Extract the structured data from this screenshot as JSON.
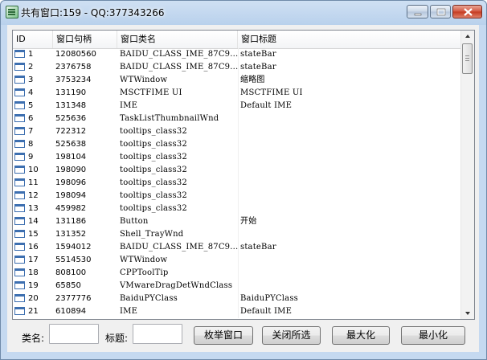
{
  "window": {
    "title": "共有窗口:159 - QQ:377343266",
    "icon": "app-icon"
  },
  "list": {
    "headers": {
      "id": "ID",
      "hwnd": "窗口句柄",
      "class": "窗口类名",
      "title": "窗口标题"
    },
    "rows": [
      {
        "id": "1",
        "hwnd": "12080560",
        "class": "BAIDU_CLASS_IME_87C9...",
        "title": "stateBar"
      },
      {
        "id": "2",
        "hwnd": "2376758",
        "class": "BAIDU_CLASS_IME_87C9...",
        "title": "stateBar"
      },
      {
        "id": "3",
        "hwnd": "3753234",
        "class": "WTWindow",
        "title": "缩略图"
      },
      {
        "id": "4",
        "hwnd": "131190",
        "class": "MSCTFIME UI",
        "title": "MSCTFIME UI"
      },
      {
        "id": "5",
        "hwnd": "131348",
        "class": "IME",
        "title": "Default IME"
      },
      {
        "id": "6",
        "hwnd": "525636",
        "class": "TaskListThumbnailWnd",
        "title": ""
      },
      {
        "id": "7",
        "hwnd": "722312",
        "class": "tooltips_class32",
        "title": ""
      },
      {
        "id": "8",
        "hwnd": "525638",
        "class": "tooltips_class32",
        "title": ""
      },
      {
        "id": "9",
        "hwnd": "198104",
        "class": "tooltips_class32",
        "title": ""
      },
      {
        "id": "10",
        "hwnd": "198090",
        "class": "tooltips_class32",
        "title": ""
      },
      {
        "id": "11",
        "hwnd": "198096",
        "class": "tooltips_class32",
        "title": ""
      },
      {
        "id": "12",
        "hwnd": "198094",
        "class": "tooltips_class32",
        "title": ""
      },
      {
        "id": "13",
        "hwnd": "459982",
        "class": "tooltips_class32",
        "title": ""
      },
      {
        "id": "14",
        "hwnd": "131186",
        "class": "Button",
        "title": "开始"
      },
      {
        "id": "15",
        "hwnd": "131352",
        "class": "Shell_TrayWnd",
        "title": ""
      },
      {
        "id": "16",
        "hwnd": "1594012",
        "class": "BAIDU_CLASS_IME_87C9...",
        "title": "stateBar"
      },
      {
        "id": "17",
        "hwnd": "5514530",
        "class": "WTWindow",
        "title": ""
      },
      {
        "id": "18",
        "hwnd": "808100",
        "class": "CPPToolTip",
        "title": ""
      },
      {
        "id": "19",
        "hwnd": "65850",
        "class": "VMwareDragDetWndClass",
        "title": ""
      },
      {
        "id": "20",
        "hwnd": "2377776",
        "class": "BaiduPYClass",
        "title": "BaiduPYClass"
      },
      {
        "id": "21",
        "hwnd": "610894",
        "class": "IME",
        "title": "Default IME"
      }
    ]
  },
  "filters": {
    "class_label": "类名:",
    "class_value": "",
    "title_label": "标题:",
    "title_value": ""
  },
  "buttons": {
    "enumerate": "枚举窗口",
    "close_selected": "关闭所选",
    "maximize": "最大化",
    "minimize": "最小化"
  }
}
